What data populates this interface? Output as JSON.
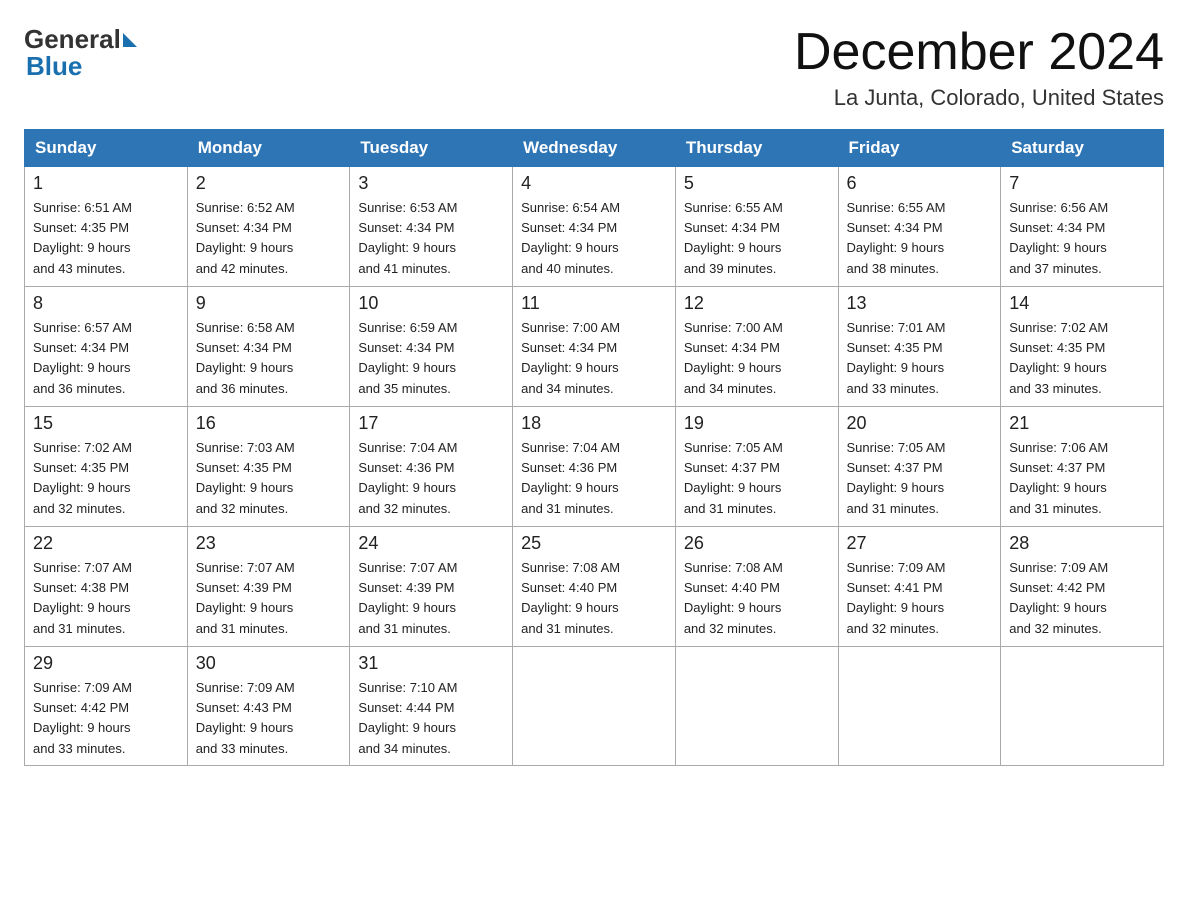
{
  "header": {
    "logo_general": "General",
    "logo_blue": "Blue",
    "title": "December 2024",
    "subtitle": "La Junta, Colorado, United States"
  },
  "weekdays": [
    "Sunday",
    "Monday",
    "Tuesday",
    "Wednesday",
    "Thursday",
    "Friday",
    "Saturday"
  ],
  "weeks": [
    [
      {
        "day": 1,
        "sunrise": "6:51 AM",
        "sunset": "4:35 PM",
        "daylight": "9 hours and 43 minutes."
      },
      {
        "day": 2,
        "sunrise": "6:52 AM",
        "sunset": "4:34 PM",
        "daylight": "9 hours and 42 minutes."
      },
      {
        "day": 3,
        "sunrise": "6:53 AM",
        "sunset": "4:34 PM",
        "daylight": "9 hours and 41 minutes."
      },
      {
        "day": 4,
        "sunrise": "6:54 AM",
        "sunset": "4:34 PM",
        "daylight": "9 hours and 40 minutes."
      },
      {
        "day": 5,
        "sunrise": "6:55 AM",
        "sunset": "4:34 PM",
        "daylight": "9 hours and 39 minutes."
      },
      {
        "day": 6,
        "sunrise": "6:55 AM",
        "sunset": "4:34 PM",
        "daylight": "9 hours and 38 minutes."
      },
      {
        "day": 7,
        "sunrise": "6:56 AM",
        "sunset": "4:34 PM",
        "daylight": "9 hours and 37 minutes."
      }
    ],
    [
      {
        "day": 8,
        "sunrise": "6:57 AM",
        "sunset": "4:34 PM",
        "daylight": "9 hours and 36 minutes."
      },
      {
        "day": 9,
        "sunrise": "6:58 AM",
        "sunset": "4:34 PM",
        "daylight": "9 hours and 36 minutes."
      },
      {
        "day": 10,
        "sunrise": "6:59 AM",
        "sunset": "4:34 PM",
        "daylight": "9 hours and 35 minutes."
      },
      {
        "day": 11,
        "sunrise": "7:00 AM",
        "sunset": "4:34 PM",
        "daylight": "9 hours and 34 minutes."
      },
      {
        "day": 12,
        "sunrise": "7:00 AM",
        "sunset": "4:34 PM",
        "daylight": "9 hours and 34 minutes."
      },
      {
        "day": 13,
        "sunrise": "7:01 AM",
        "sunset": "4:35 PM",
        "daylight": "9 hours and 33 minutes."
      },
      {
        "day": 14,
        "sunrise": "7:02 AM",
        "sunset": "4:35 PM",
        "daylight": "9 hours and 33 minutes."
      }
    ],
    [
      {
        "day": 15,
        "sunrise": "7:02 AM",
        "sunset": "4:35 PM",
        "daylight": "9 hours and 32 minutes."
      },
      {
        "day": 16,
        "sunrise": "7:03 AM",
        "sunset": "4:35 PM",
        "daylight": "9 hours and 32 minutes."
      },
      {
        "day": 17,
        "sunrise": "7:04 AM",
        "sunset": "4:36 PM",
        "daylight": "9 hours and 32 minutes."
      },
      {
        "day": 18,
        "sunrise": "7:04 AM",
        "sunset": "4:36 PM",
        "daylight": "9 hours and 31 minutes."
      },
      {
        "day": 19,
        "sunrise": "7:05 AM",
        "sunset": "4:37 PM",
        "daylight": "9 hours and 31 minutes."
      },
      {
        "day": 20,
        "sunrise": "7:05 AM",
        "sunset": "4:37 PM",
        "daylight": "9 hours and 31 minutes."
      },
      {
        "day": 21,
        "sunrise": "7:06 AM",
        "sunset": "4:37 PM",
        "daylight": "9 hours and 31 minutes."
      }
    ],
    [
      {
        "day": 22,
        "sunrise": "7:07 AM",
        "sunset": "4:38 PM",
        "daylight": "9 hours and 31 minutes."
      },
      {
        "day": 23,
        "sunrise": "7:07 AM",
        "sunset": "4:39 PM",
        "daylight": "9 hours and 31 minutes."
      },
      {
        "day": 24,
        "sunrise": "7:07 AM",
        "sunset": "4:39 PM",
        "daylight": "9 hours and 31 minutes."
      },
      {
        "day": 25,
        "sunrise": "7:08 AM",
        "sunset": "4:40 PM",
        "daylight": "9 hours and 31 minutes."
      },
      {
        "day": 26,
        "sunrise": "7:08 AM",
        "sunset": "4:40 PM",
        "daylight": "9 hours and 32 minutes."
      },
      {
        "day": 27,
        "sunrise": "7:09 AM",
        "sunset": "4:41 PM",
        "daylight": "9 hours and 32 minutes."
      },
      {
        "day": 28,
        "sunrise": "7:09 AM",
        "sunset": "4:42 PM",
        "daylight": "9 hours and 32 minutes."
      }
    ],
    [
      {
        "day": 29,
        "sunrise": "7:09 AM",
        "sunset": "4:42 PM",
        "daylight": "9 hours and 33 minutes."
      },
      {
        "day": 30,
        "sunrise": "7:09 AM",
        "sunset": "4:43 PM",
        "daylight": "9 hours and 33 minutes."
      },
      {
        "day": 31,
        "sunrise": "7:10 AM",
        "sunset": "4:44 PM",
        "daylight": "9 hours and 34 minutes."
      },
      null,
      null,
      null,
      null
    ]
  ]
}
